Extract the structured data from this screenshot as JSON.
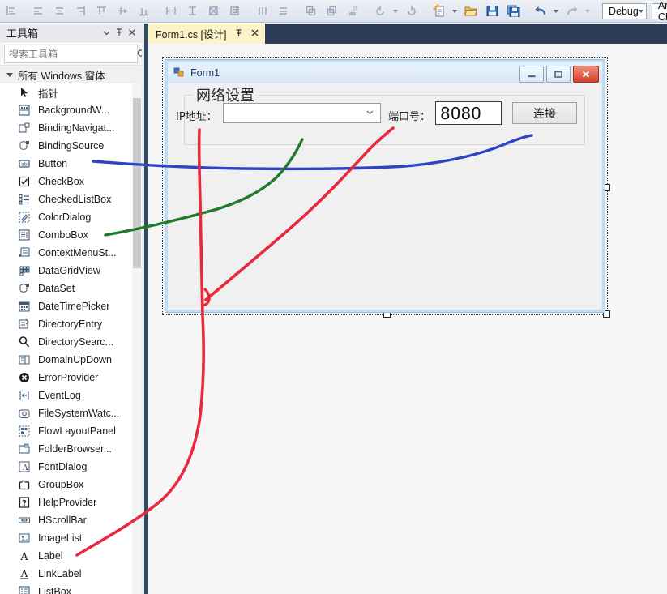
{
  "toolbar": {
    "icons": [
      {
        "name": "align-lefts-icon"
      },
      {
        "name": "align-centers-icon"
      },
      {
        "name": "align-middles-icon"
      },
      {
        "name": "align-rights-icon"
      },
      {
        "name": "align-tops-icon"
      },
      {
        "name": "align-middles-h-icon"
      },
      {
        "name": "align-bottoms-icon"
      },
      {
        "name": "make-same-width-icon"
      },
      {
        "name": "make-same-height-icon"
      },
      {
        "name": "make-same-size-icon"
      },
      {
        "name": "size-to-grid-icon"
      },
      {
        "name": "horizontal-spacing-icon"
      },
      {
        "name": "vertical-spacing-icon"
      },
      {
        "name": "bring-to-front-icon"
      },
      {
        "name": "send-to-back-icon"
      },
      {
        "name": "tab-order-icon"
      },
      {
        "name": "undo-navigate-icon"
      },
      {
        "name": "navigate-forward-icon"
      },
      {
        "name": "new-project-icon"
      },
      {
        "name": "open-file-icon"
      },
      {
        "name": "save-icon"
      },
      {
        "name": "save-all-icon"
      },
      {
        "name": "undo-icon"
      },
      {
        "name": "redo-icon"
      }
    ],
    "config_combo": {
      "value": "Debug"
    },
    "platform_combo": {
      "value": "Any CPU"
    }
  },
  "toolbox": {
    "title": "工具箱",
    "header_icons": [
      "chevron-down-icon",
      "pin-icon",
      "close-icon"
    ],
    "search_placeholder": "搜索工具箱",
    "search_value": "",
    "search_icon": "search-icon",
    "category": "所有 Windows 窗体",
    "items": [
      {
        "label": "指针",
        "icon": "pointer-icon",
        "selected": true
      },
      {
        "label": "BackgroundW...",
        "icon": "backgroundworker-icon"
      },
      {
        "label": "BindingNavigat...",
        "icon": "bindingnavigator-icon"
      },
      {
        "label": "BindingSource",
        "icon": "bindingsource-icon"
      },
      {
        "label": "Button",
        "icon": "button-icon"
      },
      {
        "label": "CheckBox",
        "icon": "checkbox-icon"
      },
      {
        "label": "CheckedListBox",
        "icon": "checkedlistbox-icon"
      },
      {
        "label": "ColorDialog",
        "icon": "colordialog-icon"
      },
      {
        "label": "ComboBox",
        "icon": "combobox-icon"
      },
      {
        "label": "ContextMenuSt...",
        "icon": "contextmenustrip-icon"
      },
      {
        "label": "DataGridView",
        "icon": "datagridview-icon"
      },
      {
        "label": "DataSet",
        "icon": "dataset-icon"
      },
      {
        "label": "DateTimePicker",
        "icon": "datetimepicker-icon"
      },
      {
        "label": "DirectoryEntry",
        "icon": "directoryentry-icon"
      },
      {
        "label": "DirectorySearc...",
        "icon": "directorysearcher-icon"
      },
      {
        "label": "DomainUpDown",
        "icon": "domainupdown-icon"
      },
      {
        "label": "ErrorProvider",
        "icon": "errorprovider-icon"
      },
      {
        "label": "EventLog",
        "icon": "eventlog-icon"
      },
      {
        "label": "FileSystemWatc...",
        "icon": "filesystemwatcher-icon"
      },
      {
        "label": "FlowLayoutPanel",
        "icon": "flowlayoutpanel-icon"
      },
      {
        "label": "FolderBrowser...",
        "icon": "folderbrowserdialog-icon"
      },
      {
        "label": "FontDialog",
        "icon": "fontdialog-icon"
      },
      {
        "label": "GroupBox",
        "icon": "groupbox-icon"
      },
      {
        "label": "HelpProvider",
        "icon": "helpprovider-icon"
      },
      {
        "label": "HScrollBar",
        "icon": "hscrollbar-icon"
      },
      {
        "label": "ImageList",
        "icon": "imagelist-icon"
      },
      {
        "label": "Label",
        "icon": "label-icon"
      },
      {
        "label": "LinkLabel",
        "icon": "linklabel-icon"
      },
      {
        "label": "ListBox",
        "icon": "listbox-icon"
      }
    ]
  },
  "tabs": [
    {
      "label": "Form1.cs [设计]",
      "pin_icon": "pin-icon",
      "close_icon": "close-icon",
      "active": true
    }
  ],
  "designer": {
    "form": {
      "title": "Form1",
      "icon": "winforms-icon",
      "minimize_label": "minimize-icon",
      "maximize_label": "maximize-icon",
      "close_label": "close-icon",
      "groupbox_title": "网络设置",
      "ip_label": "IP地址：",
      "ip_combo_value": "",
      "port_label": "端口号：",
      "port_value": "8080",
      "connect_button": "连接"
    }
  },
  "annotations": {
    "colors": {
      "red": "#e8283c",
      "green": "#1f7a29",
      "blue": "#2f44c4"
    },
    "strokes": [
      {
        "name": "label-annotation-stroke",
        "color": "#e8283c"
      },
      {
        "name": "combobox-annotation-stroke",
        "color": "#1f7a29"
      },
      {
        "name": "button-annotation-stroke",
        "color": "#2f44c4"
      },
      {
        "name": "port-annotation-stroke",
        "color": "#e8283c"
      }
    ]
  }
}
